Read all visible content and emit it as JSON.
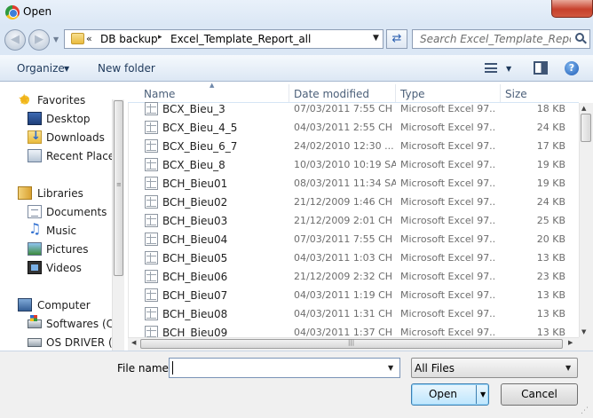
{
  "window": {
    "title": "Open"
  },
  "address": {
    "overflow_chevron": "«",
    "breadcrumbs": [
      "DB backup",
      "Excel_Template_Report_all"
    ],
    "separator": "▸"
  },
  "search": {
    "placeholder": "Search Excel_Template_Report..."
  },
  "toolbar": {
    "organize": "Organize",
    "new_folder": "New folder"
  },
  "nav": {
    "favorites": {
      "label": "Favorites",
      "items": [
        "Desktop",
        "Downloads",
        "Recent Places"
      ]
    },
    "libraries": {
      "label": "Libraries",
      "items": [
        "Documents",
        "Music",
        "Pictures",
        "Videos"
      ]
    },
    "computer": {
      "label": "Computer",
      "items": [
        "Softwares (C:)",
        "OS DRIVER (D:"
      ]
    }
  },
  "columns": {
    "name": "Name",
    "date": "Date modified",
    "type": "Type",
    "size": "Size"
  },
  "files": [
    {
      "name": "BCX_Bieu_3",
      "date": "07/03/2011 7:55 CH",
      "type": "Microsoft Excel 97...",
      "size": "18 KB"
    },
    {
      "name": "BCX_Bieu_4_5",
      "date": "04/03/2011 2:55 CH",
      "type": "Microsoft Excel 97...",
      "size": "24 KB"
    },
    {
      "name": "BCX_Bieu_6_7",
      "date": "24/02/2010 12:30 ...",
      "type": "Microsoft Excel 97...",
      "size": "17 KB"
    },
    {
      "name": "BCX_Bieu_8",
      "date": "10/03/2010 10:19 SA",
      "type": "Microsoft Excel 97...",
      "size": "19 KB"
    },
    {
      "name": "BCH_Bieu01",
      "date": "08/03/2011 11:34 SA",
      "type": "Microsoft Excel 97...",
      "size": "19 KB"
    },
    {
      "name": "BCH_Bieu02",
      "date": "21/12/2009 1:46 CH",
      "type": "Microsoft Excel 97...",
      "size": "24 KB"
    },
    {
      "name": "BCH_Bieu03",
      "date": "21/12/2009 2:01 CH",
      "type": "Microsoft Excel 97...",
      "size": "25 KB"
    },
    {
      "name": "BCH_Bieu04",
      "date": "07/03/2011 7:55 CH",
      "type": "Microsoft Excel 97...",
      "size": "20 KB"
    },
    {
      "name": "BCH_Bieu05",
      "date": "04/03/2011 1:03 CH",
      "type": "Microsoft Excel 97...",
      "size": "13 KB"
    },
    {
      "name": "BCH_Bieu06",
      "date": "21/12/2009 2:32 CH",
      "type": "Microsoft Excel 97...",
      "size": "23 KB"
    },
    {
      "name": "BCH_Bieu07",
      "date": "04/03/2011 1:19 CH",
      "type": "Microsoft Excel 97...",
      "size": "13 KB"
    },
    {
      "name": "BCH_Bieu08",
      "date": "04/03/2011 1:31 CH",
      "type": "Microsoft Excel 97...",
      "size": "13 KB"
    },
    {
      "name": "BCH_Bieu09",
      "date": "04/03/2011 1:37 CH",
      "type": "Microsoft Excel 97...",
      "size": "13 KB"
    }
  ],
  "bottom": {
    "file_name_label": "File name:",
    "file_name_value": "",
    "filter": "All Files",
    "open": "Open",
    "cancel": "Cancel"
  },
  "colors": {
    "title_bg": "#dbe7f5",
    "toolbar_text": "#1e395b",
    "header_text": "#4c607a",
    "close_red": "#c7412c",
    "open_btn": "#bee6fd"
  }
}
